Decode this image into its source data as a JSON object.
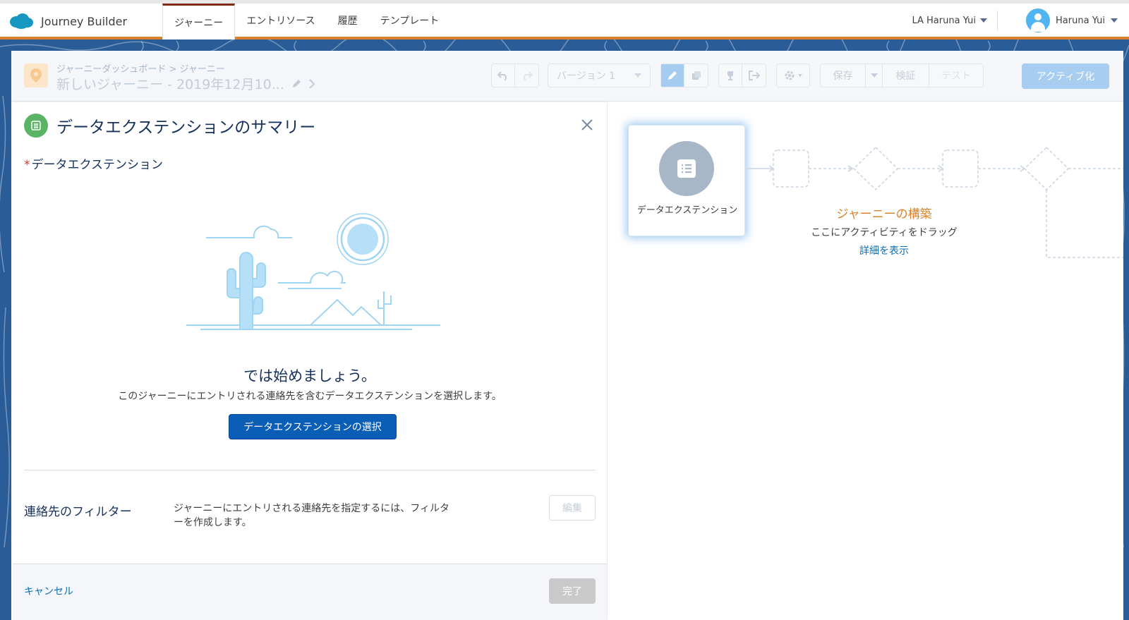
{
  "app": {
    "name": "Journey Builder"
  },
  "nav": {
    "tabs": [
      {
        "label": "ジャーニー",
        "active": true
      },
      {
        "label": "エントリソース",
        "active": false
      },
      {
        "label": "履歴",
        "active": false
      },
      {
        "label": "テンプレート",
        "active": false
      }
    ],
    "org_label": "LA Haruna Yui",
    "user_name": "Haruna Yui"
  },
  "header": {
    "breadcrumb_dashboard": "ジャーニーダッシュボード",
    "breadcrumb_sep": ">",
    "breadcrumb_current": "ジャーニー",
    "journey_title": "新しいジャーニー - 2019年12月10...",
    "version_label": "バージョン 1",
    "save_label": "保存",
    "validate_label": "検証",
    "test_label": "テスト",
    "activate_label": "アクティブ化"
  },
  "summary": {
    "title": "データエクステンションのサマリー",
    "field_label_required": "*",
    "field_label": "データエクステンション",
    "start_title": "では始めましょう。",
    "start_subtitle": "このジャーニーにエントリされる連絡先を含むデータエクステンションを選択します。",
    "select_button": "データエクステンションの選択",
    "filter_label": "連絡先のフィルター",
    "filter_description": "ジャーニーにエントリされる連絡先を指定するには、フィルターを作成します。",
    "edit_button": "編集",
    "cancel_link": "キャンセル",
    "done_button": "完了"
  },
  "canvas": {
    "entry_label": "データエクステンション",
    "build_title": "ジャーニーの構築",
    "build_subtitle": "ここにアクティビティをドラッグ",
    "build_link": "詳細を表示"
  },
  "colors": {
    "accent_orange": "#d9822b",
    "brand_blue": "#0b5eb6",
    "background_blue": "#2a5d98",
    "entry_icon_green": "#5bb466"
  }
}
